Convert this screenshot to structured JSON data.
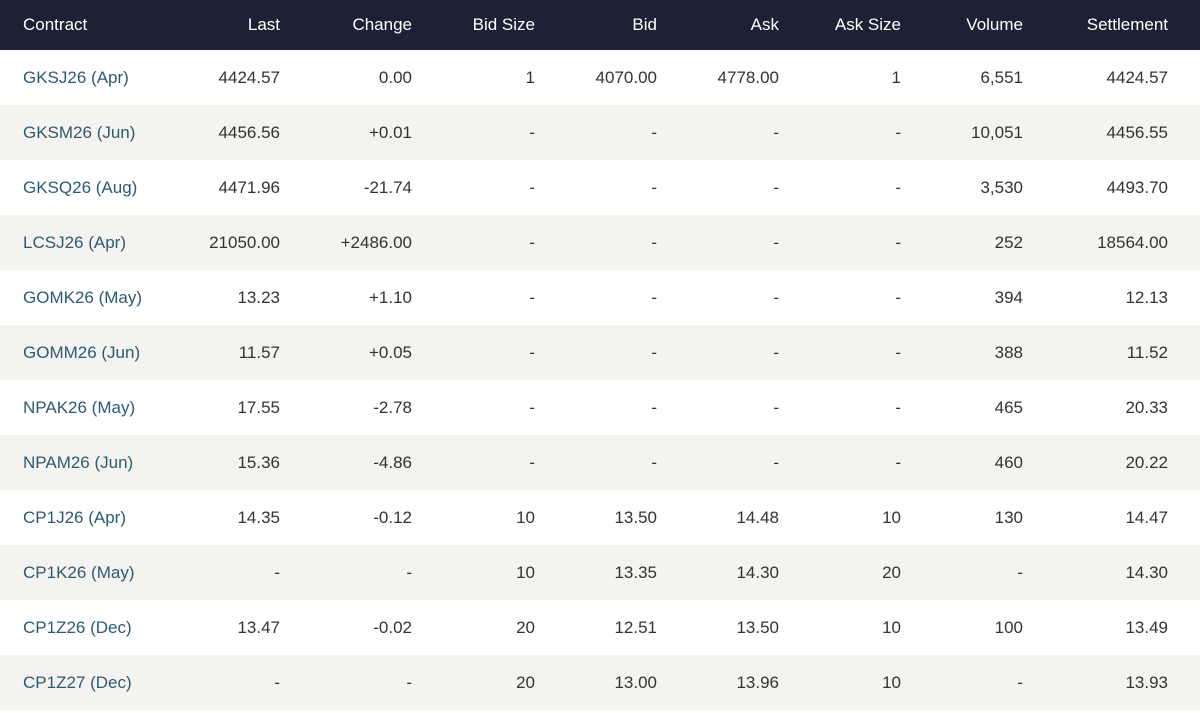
{
  "table": {
    "headers": {
      "contract": "Contract",
      "last": "Last",
      "change": "Change",
      "bid_size": "Bid Size",
      "bid": "Bid",
      "ask": "Ask",
      "ask_size": "Ask Size",
      "volume": "Volume",
      "settlement": "Settlement"
    },
    "rows": [
      {
        "contract": "GKSJ26 (Apr)",
        "last": "4424.57",
        "change": "0.00",
        "bid_size": "1",
        "bid": "4070.00",
        "ask": "4778.00",
        "ask_size": "1",
        "volume": "6,551",
        "settlement": "4424.57"
      },
      {
        "contract": "GKSM26 (Jun)",
        "last": "4456.56",
        "change": "+0.01",
        "bid_size": "-",
        "bid": "-",
        "ask": "-",
        "ask_size": "-",
        "volume": "10,051",
        "settlement": "4456.55"
      },
      {
        "contract": "GKSQ26 (Aug)",
        "last": "4471.96",
        "change": "-21.74",
        "bid_size": "-",
        "bid": "-",
        "ask": "-",
        "ask_size": "-",
        "volume": "3,530",
        "settlement": "4493.70"
      },
      {
        "contract": "LCSJ26 (Apr)",
        "last": "21050.00",
        "change": "+2486.00",
        "bid_size": "-",
        "bid": "-",
        "ask": "-",
        "ask_size": "-",
        "volume": "252",
        "settlement": "18564.00"
      },
      {
        "contract": "GOMK26 (May)",
        "last": "13.23",
        "change": "+1.10",
        "bid_size": "-",
        "bid": "-",
        "ask": "-",
        "ask_size": "-",
        "volume": "394",
        "settlement": "12.13"
      },
      {
        "contract": "GOMM26 (Jun)",
        "last": "11.57",
        "change": "+0.05",
        "bid_size": "-",
        "bid": "-",
        "ask": "-",
        "ask_size": "-",
        "volume": "388",
        "settlement": "11.52"
      },
      {
        "contract": "NPAK26 (May)",
        "last": "17.55",
        "change": "-2.78",
        "bid_size": "-",
        "bid": "-",
        "ask": "-",
        "ask_size": "-",
        "volume": "465",
        "settlement": "20.33"
      },
      {
        "contract": "NPAM26 (Jun)",
        "last": "15.36",
        "change": "-4.86",
        "bid_size": "-",
        "bid": "-",
        "ask": "-",
        "ask_size": "-",
        "volume": "460",
        "settlement": "20.22"
      },
      {
        "contract": "CP1J26 (Apr)",
        "last": "14.35",
        "change": "-0.12",
        "bid_size": "10",
        "bid": "13.50",
        "ask": "14.48",
        "ask_size": "10",
        "volume": "130",
        "settlement": "14.47"
      },
      {
        "contract": "CP1K26 (May)",
        "last": "-",
        "change": "-",
        "bid_size": "10",
        "bid": "13.35",
        "ask": "14.30",
        "ask_size": "20",
        "volume": "-",
        "settlement": "14.30"
      },
      {
        "contract": "CP1Z26 (Dec)",
        "last": "13.47",
        "change": "-0.02",
        "bid_size": "20",
        "bid": "12.51",
        "ask": "13.50",
        "ask_size": "10",
        "volume": "100",
        "settlement": "13.49"
      },
      {
        "contract": "CP1Z27 (Dec)",
        "last": "-",
        "change": "-",
        "bid_size": "20",
        "bid": "13.00",
        "ask": "13.96",
        "ask_size": "10",
        "volume": "-",
        "settlement": "13.93"
      }
    ]
  },
  "colors": {
    "header_bg": "#1c2136",
    "header_text": "#ffffff",
    "row_alt_bg": "#f5f3ef",
    "contract_link": "#2c5a73",
    "cell_text": "#333333"
  }
}
